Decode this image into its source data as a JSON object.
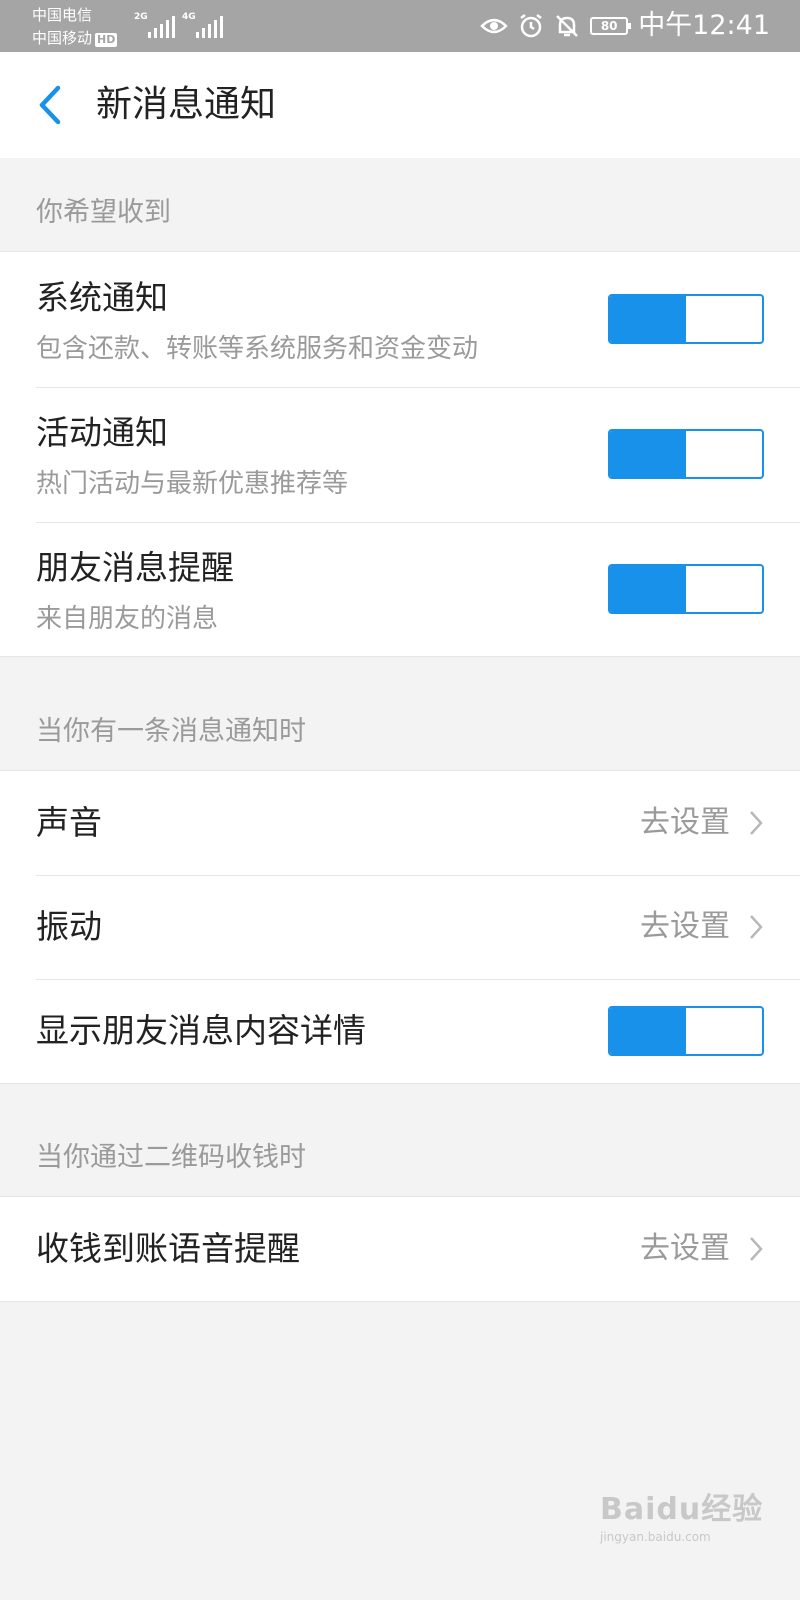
{
  "status_bar": {
    "carrier_1": "中国电信",
    "carrier_2": "中国移动",
    "hd_badge": "HD",
    "network_1": "2G",
    "network_2": "4G",
    "battery": "80",
    "time": "中午12:41",
    "icons": [
      "eye-icon",
      "alarm-icon",
      "bell-off-icon",
      "battery-icon"
    ]
  },
  "nav": {
    "title": "新消息通知",
    "back_icon": "chevron-left-icon"
  },
  "sections": {
    "receive": {
      "header": "你希望收到",
      "items": [
        {
          "title": "系统通知",
          "subtitle": "包含还款、转账等系统服务和资金变动",
          "enabled": true
        },
        {
          "title": "活动通知",
          "subtitle": "热门活动与最新优惠推荐等",
          "enabled": true
        },
        {
          "title": "朋友消息提醒",
          "subtitle": "来自朋友的消息",
          "enabled": true
        }
      ]
    },
    "on_notify": {
      "header": "当你有一条消息通知时",
      "sound": {
        "title": "声音",
        "action": "去设置"
      },
      "vibrate": {
        "title": "振动",
        "action": "去设置"
      },
      "show_detail": {
        "title": "显示朋友消息内容详情",
        "enabled": true
      }
    },
    "qr_pay": {
      "header": "当你通过二维码收钱时",
      "voice": {
        "title": "收钱到账语音提醒",
        "action": "去设置"
      }
    }
  },
  "colors": {
    "accent": "#1891ea",
    "status_bar": "#a5a5a5",
    "background": "#f3f3f3",
    "secondary_text": "#9a9a9a"
  },
  "watermark": {
    "main": "Baidu经验",
    "sub": "jingyan.baidu.com"
  }
}
